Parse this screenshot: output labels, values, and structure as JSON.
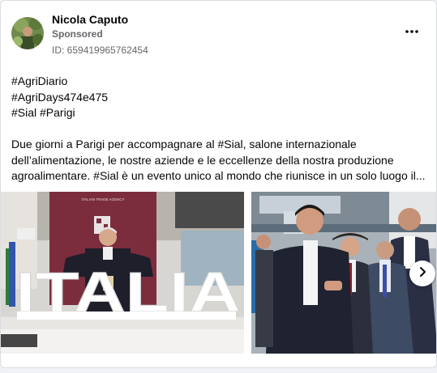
{
  "post": {
    "author": "Nicola Caputo",
    "sponsored_label": "Sponsored",
    "ad_id": "ID: 659419965762454",
    "hashtags": [
      "#AgriDiario",
      "#AgriDays474e475",
      "#Sial #Parigi"
    ],
    "paragraph": [
      "Due giorni a Parigi per accompagnare al #Sial, salone internazionale",
      "dell’alimentazione, le nostre aziende e le eccellenze della nostra produzione",
      "agroalimentare. #Sial è un evento unico al mondo che riunisce in un solo luogo il..."
    ]
  },
  "carousel": {
    "slide1": {
      "sign_text": "ITALIAN TRADE AGENCY",
      "letters": "ITALIA"
    }
  },
  "icons": {
    "more": "more-options-icon",
    "next": "chevron-right-icon"
  },
  "colors": {
    "name": "#050505",
    "secondary": "#65676b",
    "booth_wall": "#7b2d3e"
  }
}
